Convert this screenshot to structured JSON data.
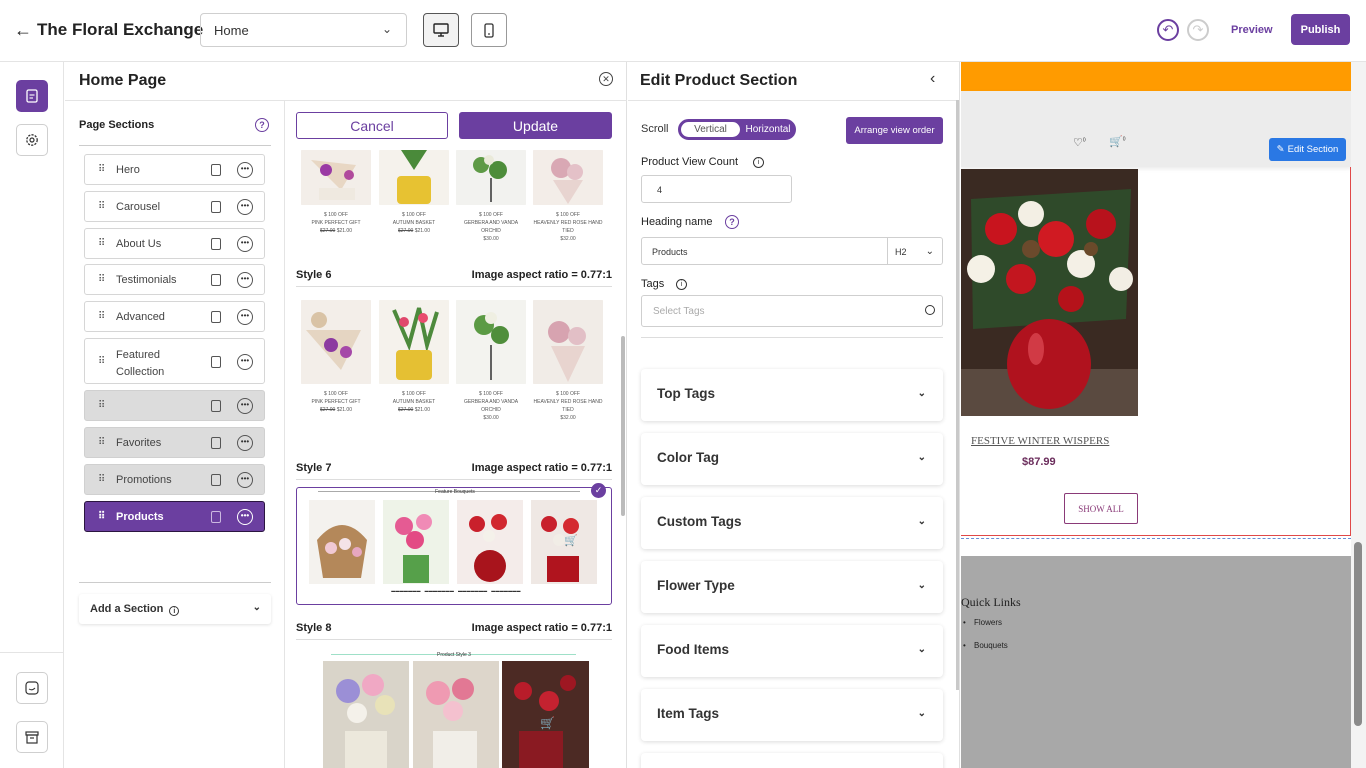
{
  "topbar": {
    "brand": "The Floral Exchange",
    "page_select": "Home",
    "preview_label": "Preview",
    "publish_label": "Publish"
  },
  "home_panel": {
    "title": "Home Page",
    "page_sections_title": "Page Sections",
    "sections": [
      {
        "label": "Hero",
        "state": "normal"
      },
      {
        "label": "Carousel",
        "state": "normal"
      },
      {
        "label": "About Us",
        "state": "normal"
      },
      {
        "label": "Testimonials",
        "state": "normal"
      },
      {
        "label": "Advanced",
        "state": "normal"
      },
      {
        "label": "Featured Collection",
        "state": "normal"
      },
      {
        "label": "",
        "state": "grey"
      },
      {
        "label": "Favorites",
        "state": "grey"
      },
      {
        "label": "Promotions",
        "state": "grey"
      },
      {
        "label": "Products",
        "state": "active"
      }
    ],
    "add_section_label": "Add a Section"
  },
  "styles": {
    "cancel_label": "Cancel",
    "update_label": "Update",
    "products_top": [
      {
        "offer": "$ 100 OFF",
        "name": "PINK PERFECT GIFT",
        "old": "$27.00",
        "price": "$21.00"
      },
      {
        "offer": "$ 100 OFF",
        "name": "AUTUMN BASKET",
        "old": "$27.00",
        "price": "$21.00"
      },
      {
        "offer": "$ 100 OFF",
        "name": "GERBERA AND VANDA ORCHID",
        "old": "",
        "price": "$30.00"
      },
      {
        "offer": "$ 100 OFF",
        "name": "HEAVENLY RED ROSE HAND TIED",
        "old": "",
        "price": "$32.00"
      }
    ],
    "style6_label": "Style 6",
    "style7_label": "Style 7",
    "style8_label": "Style 8",
    "ratio_label": "Image aspect ratio = 0.77:1",
    "style7_heading": "Feature Bouquets",
    "style8_heading": "Product Style 3"
  },
  "edit_panel": {
    "title": "Edit Product Section",
    "scroll_label": "Scroll",
    "vertical_label": "Vertical",
    "horizontal_label": "Horizontal",
    "arrange_label": "Arrange view order",
    "product_view_count_label": "Product View Count",
    "product_view_count_value": "4",
    "heading_name_label": "Heading name",
    "heading_name_value": "Products",
    "heading_level": "H2",
    "tags_label": "Tags",
    "tags_placeholder": "Select Tags",
    "accordions": [
      "Top Tags",
      "Color Tag",
      "Custom Tags",
      "Flower Type",
      "Food Items",
      "Item Tags"
    ]
  },
  "preview": {
    "edit_section_label": "Edit Section",
    "wishlist_count": "0",
    "cart_count": "0",
    "product_name": "FESTIVE WINTER WISPERS",
    "product_price": "$87.99",
    "show_all_label": "SHOW ALL",
    "quick_links_title": "Quick Links",
    "quick_links": [
      "Flowers",
      "Bouquets"
    ]
  },
  "colors": {
    "accent": "#6b3fa0",
    "orange": "#ff9b00",
    "edit_blue": "#2a78e4"
  }
}
